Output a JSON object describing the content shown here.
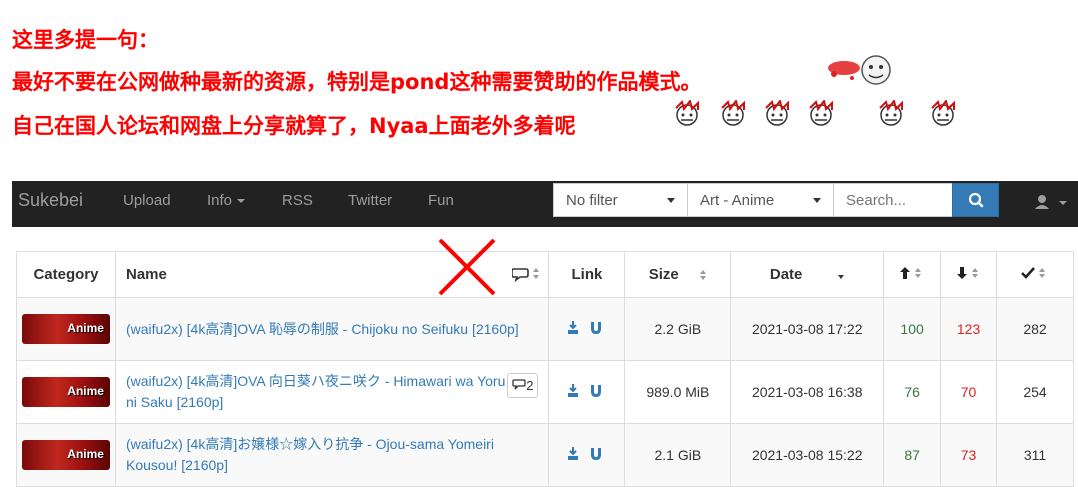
{
  "annotation": {
    "line1": "这里多提一句：",
    "line2": "最好不要在公网做种最新的资源，特别是pond这种需要赞助的作品模式。",
    "line3": "自己在国人论坛和网盘上分享就算了，Nyaa上面老外多着呢"
  },
  "navbar": {
    "brand": "Sukebei",
    "links": {
      "upload": "Upload",
      "info": "Info",
      "rss": "RSS",
      "twitter": "Twitter",
      "fun": "Fun"
    },
    "filter_value": "No filter",
    "category_value": "Art - Anime",
    "search_placeholder": "Search..."
  },
  "table": {
    "headers": {
      "category": "Category",
      "name": "Name",
      "link": "Link",
      "size": "Size",
      "date": "Date"
    },
    "rows": [
      {
        "category": "Anime",
        "name": "(waifu2x) [4k高清]OVA 恥辱の制服 - Chijoku no Seifuku [2160p]",
        "comments": "",
        "size": "2.2 GiB",
        "date": "2021-03-08 17:22",
        "seeders": "100",
        "leechers": "123",
        "completed": "282"
      },
      {
        "category": "Anime",
        "name": "(waifu2x) [4k高清]OVA 向日葵ハ夜ニ咲ク - Himawari wa Yoru ni Saku [2160p]",
        "comments": "2",
        "size": "989.0 MiB",
        "date": "2021-03-08 16:38",
        "seeders": "76",
        "leechers": "70",
        "completed": "254"
      },
      {
        "category": "Anime",
        "name": "(waifu2x) [4k高清]お嬢様☆嫁入り抗争 - Ojou-sama Yomeiri Kousou! [2160p]",
        "comments": "",
        "size": "2.1 GiB",
        "date": "2021-03-08 15:22",
        "seeders": "87",
        "leechers": "73",
        "completed": "311"
      }
    ]
  },
  "colors": {
    "annotation": "#ff0000",
    "navbar": "#222222",
    "link": "#337ab7",
    "seeders": "#3c763d",
    "leechers": "#dd2222",
    "search_button": "#337ab7"
  }
}
